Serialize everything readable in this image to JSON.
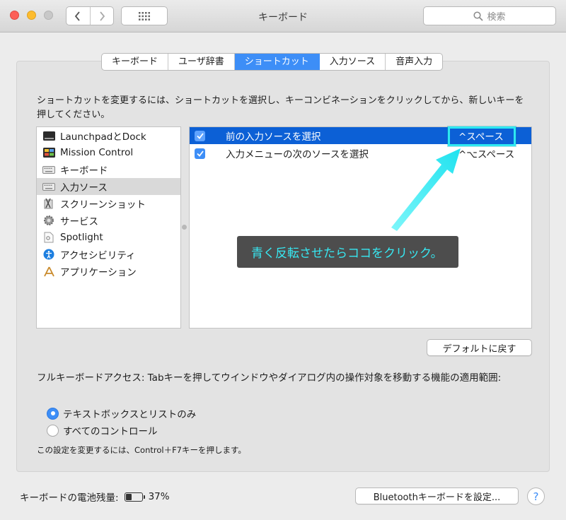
{
  "window": {
    "title": "キーボード",
    "search_placeholder": "検索"
  },
  "tabs": [
    {
      "label": "キーボード",
      "selected": false
    },
    {
      "label": "ユーザ辞書",
      "selected": false
    },
    {
      "label": "ショートカット",
      "selected": true
    },
    {
      "label": "入力ソース",
      "selected": false
    },
    {
      "label": "音声入力",
      "selected": false
    }
  ],
  "instructions": "ショートカットを変更するには、ショートカットを選択し、キーコンビネーションをクリックしてから、新しいキーを押してください。",
  "categories": [
    {
      "label": "LaunchpadとDock",
      "icon": "launchpad-dock-icon"
    },
    {
      "label": "Mission Control",
      "icon": "mission-control-icon"
    },
    {
      "label": "キーボード",
      "icon": "keyboard-icon"
    },
    {
      "label": "入力ソース",
      "icon": "keyboard-icon",
      "selected": true
    },
    {
      "label": "スクリーンショット",
      "icon": "screenshot-icon"
    },
    {
      "label": "サービス",
      "icon": "gear-icon"
    },
    {
      "label": "Spotlight",
      "icon": "spotlight-icon"
    },
    {
      "label": "アクセシビリティ",
      "icon": "accessibility-icon"
    },
    {
      "label": "アプリケーション",
      "icon": "applications-icon"
    }
  ],
  "shortcuts": [
    {
      "label": "前の入力ソースを選択",
      "key": "^スペース",
      "checked": true,
      "selected": true
    },
    {
      "label": "入力メニューの次のソースを選択",
      "key": "^⌥スペース",
      "checked": true,
      "selected": false
    }
  ],
  "annotation": {
    "callout": "青く反転させたらココをクリック。",
    "color": "#2ee8f1"
  },
  "buttons": {
    "restore_defaults": "デフォルトに戻す",
    "setup_bluetooth": "Bluetoothキーボードを設定..."
  },
  "full_keyboard_access": {
    "description": "フルキーボードアクセス: Tabキーを押してウインドウやダイアログ内の操作対象を移動する機能の適用範囲:",
    "options": [
      {
        "label": "テキストボックスとリストのみ",
        "selected": true
      },
      {
        "label": "すべてのコントロール",
        "selected": false
      }
    ],
    "note": "この設定を変更するには、Control＋F7キーを押します。"
  },
  "battery": {
    "label": "キーボードの電池残量:",
    "percent_text": "37%",
    "level": 0.37
  },
  "help_label": "?",
  "colors": {
    "accent": "#3d8ef7",
    "selection": "#0c60d6",
    "callout_bg": "#4d4d4d"
  }
}
